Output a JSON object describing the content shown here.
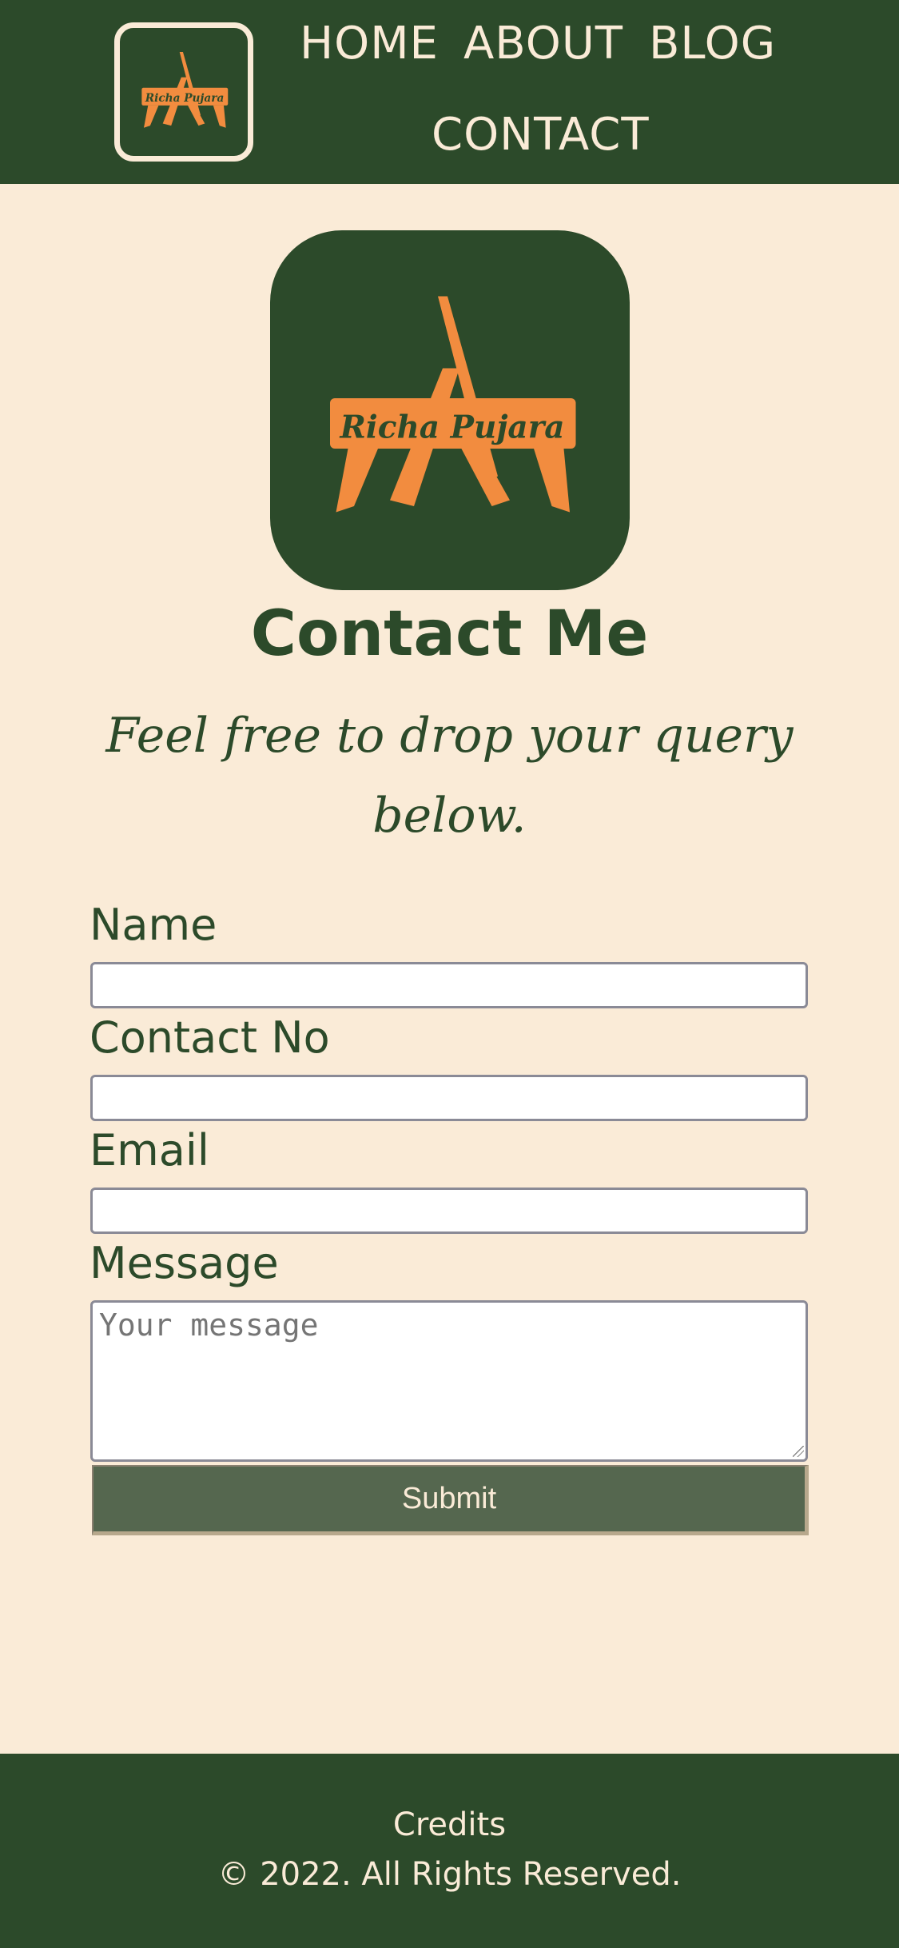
{
  "header": {
    "nav": [
      "HOME",
      "ABOUT",
      "BLOG",
      "CONTACT"
    ],
    "logo_text": "Richa Pujara"
  },
  "hero": {
    "logo_text": "Richa Pujara",
    "title": "Contact Me",
    "subtitle": "Feel free to drop your query below."
  },
  "form": {
    "name_label": "Name",
    "contact_label": "Contact No",
    "email_label": "Email",
    "message_label": "Message",
    "message_placeholder": "Your message",
    "submit_label": "Submit"
  },
  "footer": {
    "credits": "Credits",
    "copyright": "© 2022. All Rights Reserved."
  },
  "colors": {
    "primary": "#2c4a2a",
    "background": "#faebd7",
    "accent": "#f28c3f",
    "button": "#55674f"
  },
  "icons": {
    "logo": "easel-paintbrush-logo-icon"
  }
}
